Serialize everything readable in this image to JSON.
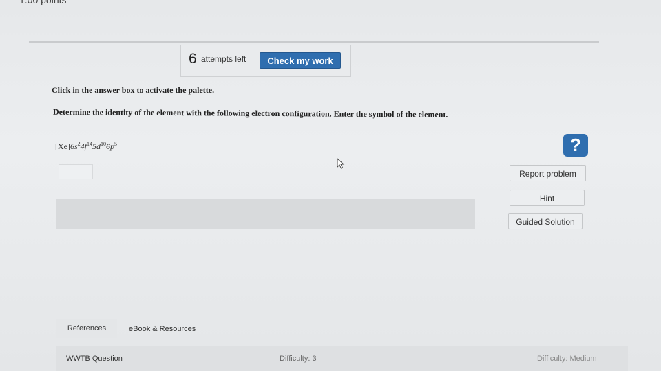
{
  "header": {
    "points_text": "1.00 points"
  },
  "toolbar": {
    "attempts_count": "6",
    "attempts_label": "attempts left",
    "check_label": "Check my work"
  },
  "question": {
    "instruction": "Click in the answer box to activate the palette.",
    "prompt": "Determine the identity of the element with the following electron configuration. Enter the symbol of the element.",
    "config": {
      "core": "[Xe]",
      "parts": [
        {
          "base": "6s",
          "exp": "2"
        },
        {
          "base": "4f",
          "exp": "14"
        },
        {
          "base": "5d",
          "exp": "10"
        },
        {
          "base": "6p",
          "exp": "5"
        }
      ]
    },
    "answer_value": ""
  },
  "sidebar": {
    "help_glyph": "?",
    "report_label": "Report problem",
    "hint_label": "Hint",
    "guided_label": "Guided Solution"
  },
  "tabs": {
    "references": "References",
    "ebook": "eBook & Resources"
  },
  "footer": {
    "question_type": "WWTB Question",
    "difficulty_num": "Difficulty: 3",
    "difficulty_level": "Difficulty: Medium"
  },
  "colors": {
    "accent": "#2f6eaf"
  }
}
